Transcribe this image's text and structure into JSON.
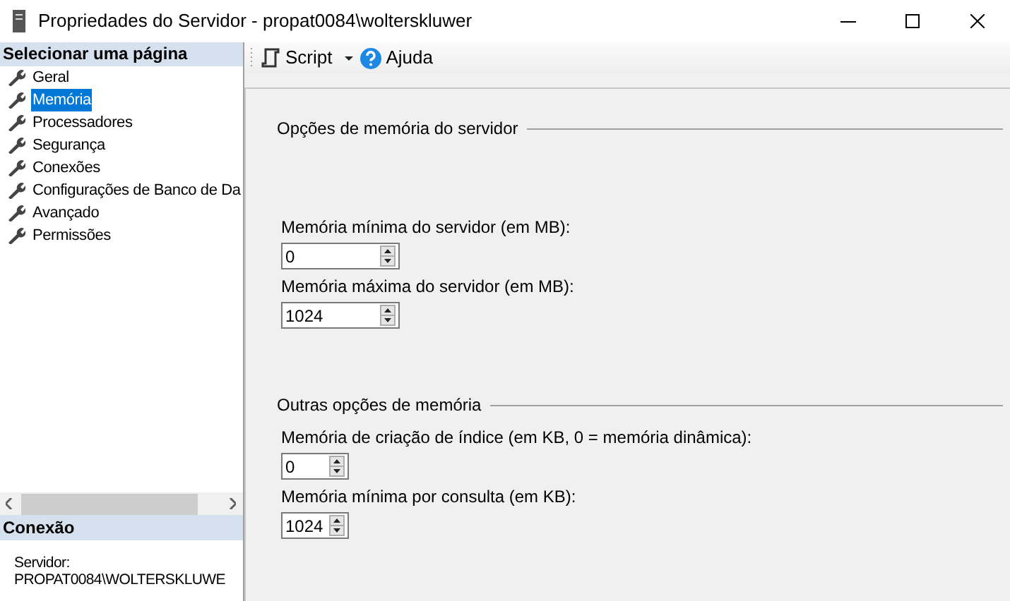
{
  "window": {
    "title": "Propriedades do Servidor - propat0084\\wolterskluwer"
  },
  "sidebar": {
    "header": "Selecionar uma página",
    "items": [
      {
        "label": "Geral",
        "selected": false
      },
      {
        "label": "Memória",
        "selected": true
      },
      {
        "label": "Processadores",
        "selected": false
      },
      {
        "label": "Segurança",
        "selected": false
      },
      {
        "label": "Conexões",
        "selected": false
      },
      {
        "label": "Configurações de Banco de Da",
        "selected": false
      },
      {
        "label": "Avançado",
        "selected": false
      },
      {
        "label": "Permissões",
        "selected": false
      }
    ]
  },
  "connection": {
    "header": "Conexão",
    "server_label": "Servidor:",
    "server": "PROPAT0084\\WOLTERSKLUWE"
  },
  "toolbar": {
    "script": "Script",
    "help": "Ajuda"
  },
  "groups": [
    {
      "title": "Opções de memória do servidor",
      "fields": [
        {
          "label": "Memória mínima do servidor (em MB):",
          "value": "0"
        },
        {
          "label": "Memória máxima do servidor (em MB):",
          "value": "1024"
        }
      ]
    },
    {
      "title": "Outras opções de memória",
      "fields": [
        {
          "label": "Memória de criação de índice (em KB, 0 = memória dinâmica):",
          "value": "0"
        },
        {
          "label": "Memória mínima por consulta (em KB):",
          "value": "1024"
        }
      ]
    }
  ]
}
